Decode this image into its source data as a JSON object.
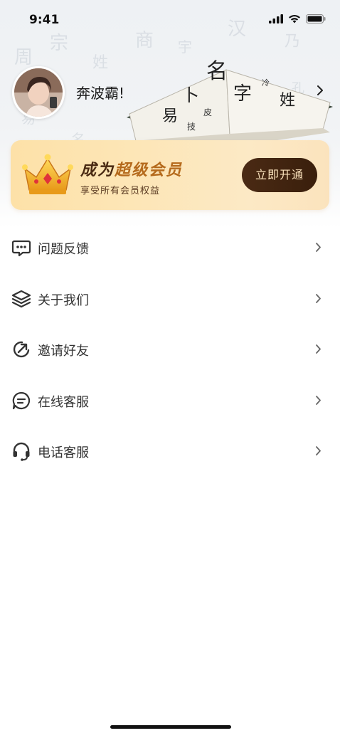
{
  "status_bar": {
    "time": "9:41",
    "icons": [
      "signal-icon",
      "wifi-icon",
      "battery-icon"
    ]
  },
  "profile": {
    "username": "奔波霸!"
  },
  "vip_banner": {
    "title_part1": "成为",
    "title_part2": "超级会员",
    "subtitle": "享受所有会员权益",
    "button_label": "立即开通"
  },
  "menu": {
    "items": [
      {
        "label": "问题反馈",
        "icon": "feedback-icon"
      },
      {
        "label": "关于我们",
        "icon": "layers-icon"
      },
      {
        "label": "邀请好友",
        "icon": "share-icon"
      },
      {
        "label": "在线客服",
        "icon": "chat-icon"
      },
      {
        "label": "电话客服",
        "icon": "headset-icon"
      }
    ]
  },
  "colors": {
    "vip_dark": "#4a2a12",
    "vip_accent": "#b56a1c",
    "vip_bg": "#fde6b7"
  }
}
